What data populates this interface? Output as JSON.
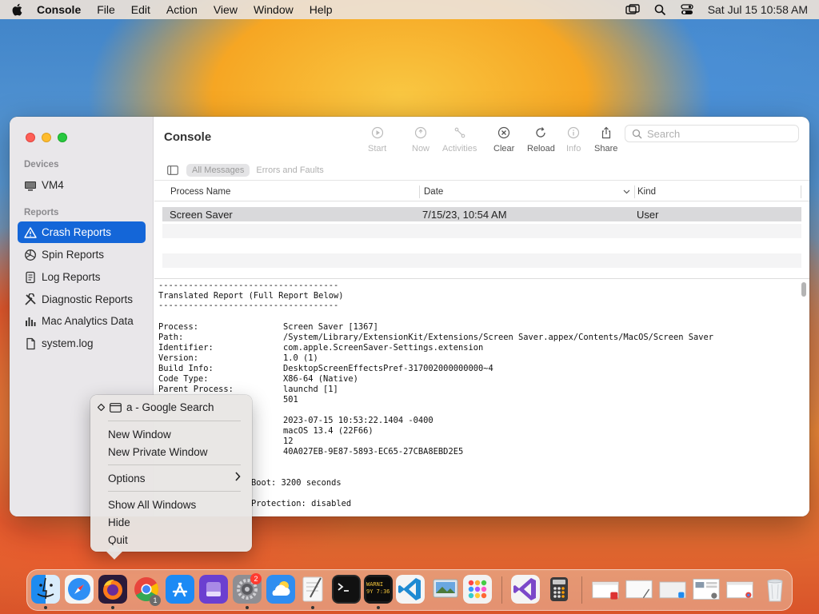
{
  "menubar": {
    "app_name": "Console",
    "menus": [
      "File",
      "Edit",
      "Action",
      "View",
      "Window",
      "Help"
    ],
    "clock": "Sat Jul 15  10:58 AM"
  },
  "window": {
    "title": "Console",
    "sidebar": {
      "devices_header": "Devices",
      "device": "VM4",
      "reports_header": "Reports",
      "items": [
        "Crash Reports",
        "Spin Reports",
        "Log Reports",
        "Diagnostic Reports",
        "Mac Analytics Data",
        "system.log"
      ]
    },
    "toolbar": {
      "start": "Start",
      "now": "Now",
      "activities": "Activities",
      "clear": "Clear",
      "reload": "Reload",
      "info": "Info",
      "share": "Share",
      "search_placeholder": "Search"
    },
    "filters": {
      "all_messages": "All Messages",
      "errors_faults": "Errors and Faults"
    },
    "table": {
      "columns": [
        "Process Name",
        "Date",
        "Kind"
      ],
      "rows": [
        {
          "process": "Screen Saver",
          "date": "7/15/23, 10:54 AM",
          "kind": "User"
        }
      ]
    },
    "report": {
      "rule": "------------------------------------",
      "heading": "Translated Report (Full Report Below)",
      "fields": [
        {
          "label": "Process:",
          "value": "Screen Saver [1367]"
        },
        {
          "label": "Path:",
          "value": "/System/Library/ExtensionKit/Extensions/Screen Saver.appex/Contents/MacOS/Screen Saver"
        },
        {
          "label": "Identifier:",
          "value": "com.apple.ScreenSaver-Settings.extension"
        },
        {
          "label": "Version:",
          "value": "1.0 (1)"
        },
        {
          "label": "Build Info:",
          "value": "DesktopScreenEffectsPref-317002000000000~4"
        },
        {
          "label": "Code Type:",
          "value": "X86-64 (Native)"
        },
        {
          "label": "Parent Process:",
          "value": "launchd [1]"
        },
        {
          "label": "",
          "value": "501"
        },
        {
          "label": "",
          "value": "2023-07-15 10:53:22.1404 -0400"
        },
        {
          "label": "",
          "value": "macOS 13.4 (22F66)"
        },
        {
          "label": "",
          "value": "12"
        },
        {
          "label": "",
          "value": "40A027EB-9E87-5893-EC65-27CBA8EBD2E5"
        }
      ],
      "partial_1": "Boot: 3200 seconds",
      "partial_2": "Protection: disabled"
    }
  },
  "context_menu": {
    "window_item": "a - Google Search",
    "items": [
      "New Window",
      "New Private Window",
      "Options",
      "Show All Windows",
      "Hide",
      "Quit"
    ]
  },
  "dock": {
    "settings_badge": "2",
    "chrome_badge": "1",
    "console_icon_text": "WARNI 9Y 7:36"
  }
}
